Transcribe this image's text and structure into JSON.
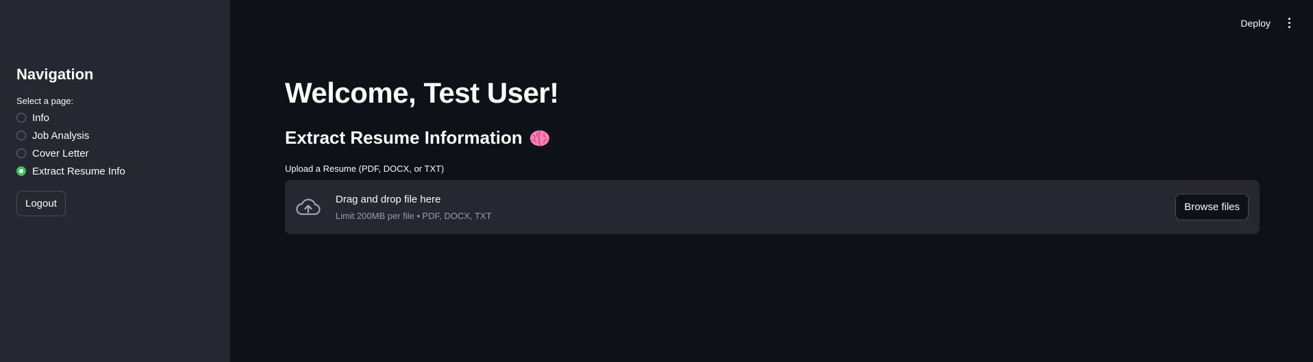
{
  "sidebar": {
    "title": "Navigation",
    "select_label": "Select a page:",
    "options": [
      {
        "label": "Info",
        "selected": false
      },
      {
        "label": "Job Analysis",
        "selected": false
      },
      {
        "label": "Cover Letter",
        "selected": false
      },
      {
        "label": "Extract Resume Info",
        "selected": true
      }
    ],
    "logout_label": "Logout"
  },
  "header": {
    "deploy_label": "Deploy",
    "menu_icon": "kebab-menu-icon"
  },
  "main": {
    "welcome": "Welcome, Test User!",
    "section_title": "Extract Resume Information",
    "section_icon": "brain-icon",
    "upload": {
      "label": "Upload a Resume (PDF, DOCX, or TXT)",
      "drop_text": "Drag and drop file here",
      "limit_text": "Limit 200MB per file • PDF, DOCX, TXT",
      "browse_label": "Browse files",
      "icon": "cloud-upload-icon"
    }
  },
  "colors": {
    "background": "#0e1117",
    "sidebar": "#262730",
    "accent_selected": "#3ec25a",
    "brain": "#ff7eb6"
  }
}
